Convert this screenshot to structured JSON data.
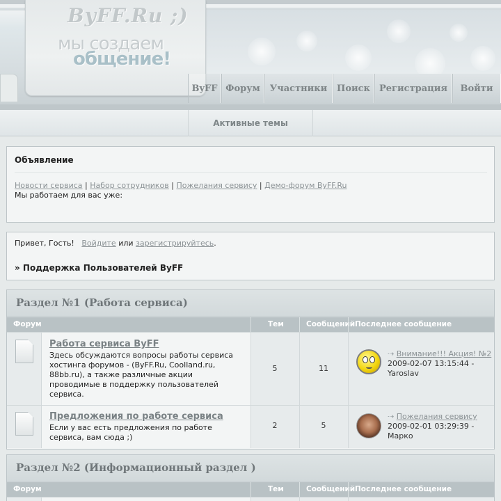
{
  "header": {
    "logo_title": "ByFF.Ru ;)",
    "slogan_line1": "мы создаем",
    "slogan_line2": "общение!"
  },
  "nav": {
    "items": [
      "ByFF",
      "Форум",
      "Участники",
      "Поиск",
      "Регистрация",
      "Войти"
    ]
  },
  "subnav": {
    "active_topics": "Активные темы"
  },
  "announcement": {
    "title": "Объявление",
    "links": [
      "Новости сервиса",
      "Набор сотрудников",
      "Пожелания сервису",
      "Демо-форум ByFF.Ru"
    ],
    "separator": "|",
    "note": "Мы работаем для вас уже:"
  },
  "guest": {
    "greeting": "Привет, Гость!",
    "login": "Войдите",
    "or": "или",
    "register": "зарегистрируйтесь",
    "period": ".",
    "crumb": "» Поддержка Пользователей ByFF"
  },
  "columns": {
    "forum": "Форум",
    "topics": "Тем",
    "posts": "Сообщений",
    "last": "Последнее сообщение"
  },
  "sections": [
    {
      "title": "Раздел №1 (Работа сервиса)",
      "forums": [
        {
          "name": "Работа сервиса ByFF",
          "description": "Здесь обсуждаются вопросы работы сервиса хостинга форумов - (ByFF.Ru, Coolland.ru, 88bb.ru), а также различные акции проводимые в поддержку пользователей сервиса.",
          "topics": "5",
          "posts": "11",
          "last_topic": "Внимание!!! Акция! №2",
          "last_date": "2009-02-07 13:15:44 -",
          "last_author": "Yaroslav",
          "avatar": "smiley-avatar"
        },
        {
          "name": "Предложения по работе сервиса",
          "description": "Если у вас есть предложения по работе сервиса, вам сюда ;)",
          "topics": "2",
          "posts": "5",
          "last_topic": "Пожелания сервису",
          "last_date": "2009-02-01 03:29:39 -",
          "last_author": "Марко",
          "avatar": "photo-avatar"
        }
      ]
    },
    {
      "title": "Раздел №2 (Информационный раздел )"
    }
  ],
  "colors": {
    "bg": "#e6eaea",
    "col_head": "#b9c2c5",
    "link": "#8a9194"
  }
}
